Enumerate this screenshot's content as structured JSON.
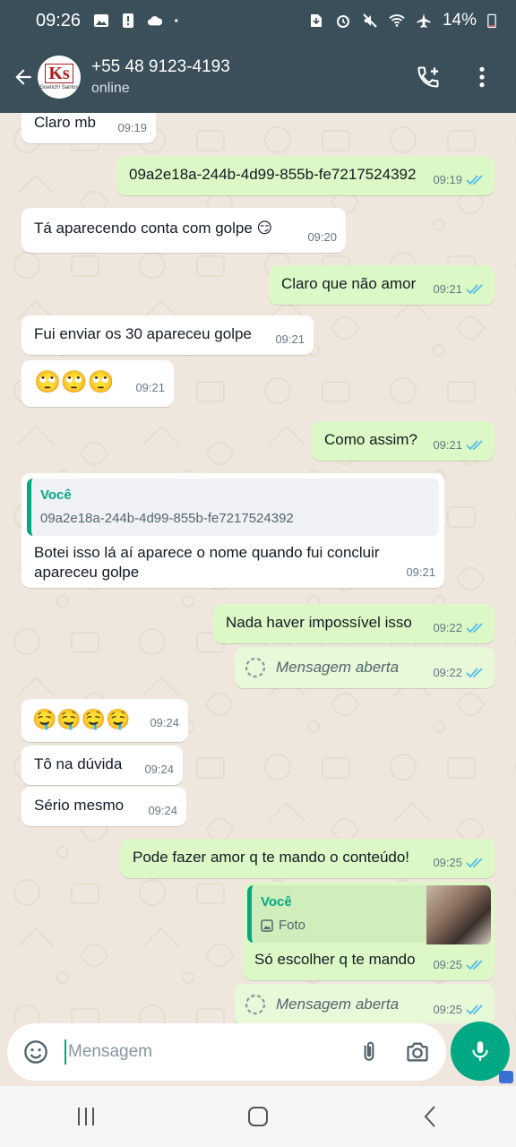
{
  "status_bar": {
    "time": "09:26",
    "battery": "14%",
    "left_icons": [
      "gallery-icon",
      "alert-icon",
      "cloud-icon",
      "dot-icon"
    ],
    "right_icons": [
      "sd-icon",
      "alarm-icon",
      "mute-icon",
      "wifi-icon",
      "airplane-icon",
      "battery-icon"
    ]
  },
  "header": {
    "contact_name": "+55 48 9123-4193",
    "status": "online",
    "avatar_text": "Ks",
    "avatar_subtext": "Goerich! Santos"
  },
  "messages": [
    {
      "dir": "in",
      "text": "Claro mb",
      "time": "09:19"
    },
    {
      "dir": "out",
      "text": "09a2e18a-244b-4d99-855b-fe7217524392",
      "time": "09:19"
    },
    {
      "dir": "in",
      "text": "Tá aparecendo conta com golpe 😏",
      "time": "09:20"
    },
    {
      "dir": "out",
      "text": "Claro que não amor",
      "time": "09:21"
    },
    {
      "dir": "in",
      "text": "Fui enviar os 30 apareceu golpe",
      "time": "09:21"
    },
    {
      "dir": "in",
      "text": "🙄🙄🙄",
      "time": "09:21"
    },
    {
      "dir": "out",
      "text": "Como assim?",
      "time": "09:21"
    },
    {
      "dir": "in",
      "quote_name": "Você",
      "quote_text": "09a2e18a-244b-4d99-855b-fe7217524392",
      "text": "Botei isso lá aí aparece o nome quando fui concluir apareceu golpe",
      "time": "09:21"
    },
    {
      "dir": "out",
      "text": "Nada haver impossível isso",
      "time": "09:22"
    },
    {
      "dir": "out",
      "text": "Mensagem aberta",
      "time": "09:22"
    },
    {
      "dir": "in",
      "text": "🤤🤤🤤🤤",
      "time": "09:24"
    },
    {
      "dir": "in",
      "text": "Tô na dúvida",
      "time": "09:24"
    },
    {
      "dir": "in",
      "text": "Sério mesmo",
      "time": "09:24"
    },
    {
      "dir": "out",
      "text": "Pode fazer amor q te mando o conteúdo!",
      "time": "09:25"
    },
    {
      "dir": "out",
      "quote_name": "Você",
      "quote_text": "Foto",
      "text": "Só escolher q te mando",
      "time": "09:25"
    },
    {
      "dir": "out",
      "text": "Mensagem aberta",
      "time": "09:25"
    }
  ],
  "input": {
    "placeholder": "Mensagem"
  },
  "colors": {
    "header": "#3a4f5a",
    "accent": "#00a884",
    "outgoing": "#dcf8c6",
    "incoming": "#ffffff",
    "read_ticks": "#53bdeb"
  }
}
